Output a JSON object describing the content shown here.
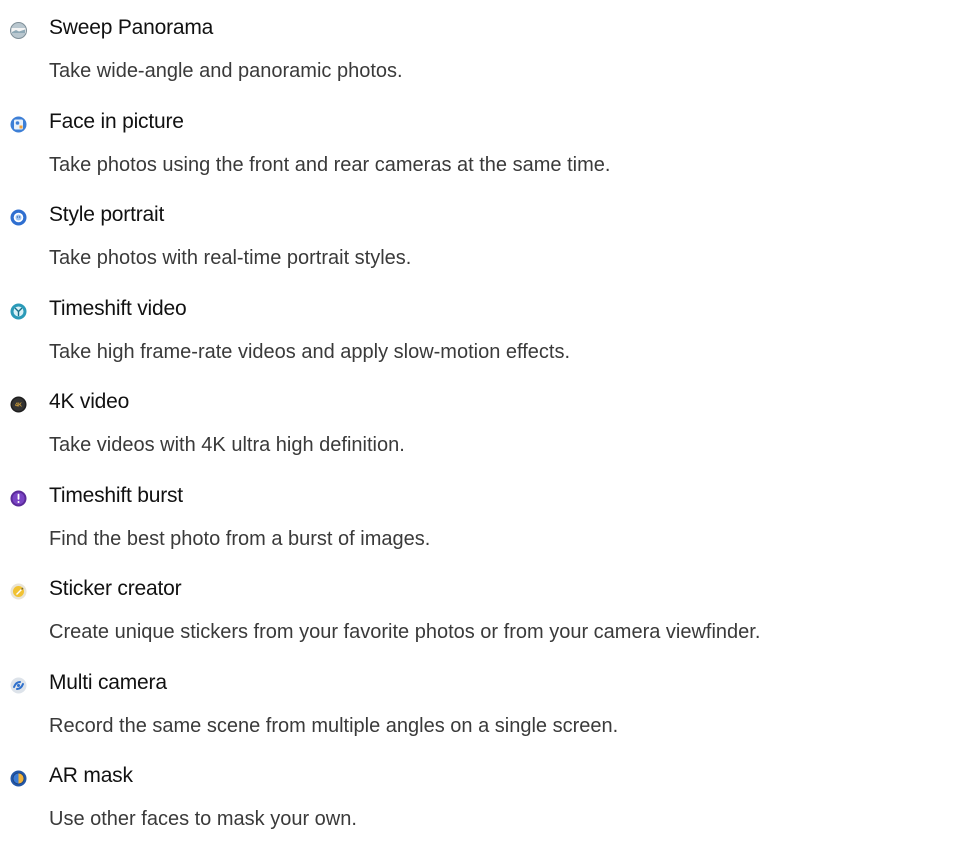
{
  "modes": [
    {
      "icon": "panorama-icon",
      "title": "Sweep Panorama",
      "description": "Take wide-angle and panoramic photos."
    },
    {
      "icon": "face-in-picture-icon",
      "title": "Face in picture",
      "description": "Take photos using the front and rear cameras at the same time."
    },
    {
      "icon": "style-portrait-icon",
      "title": "Style portrait",
      "description": "Take photos with real-time portrait styles."
    },
    {
      "icon": "timeshift-video-icon",
      "title": "Timeshift video",
      "description": "Take high frame-rate videos and apply slow-motion effects."
    },
    {
      "icon": "4k-video-icon",
      "icon_text": "4K",
      "title": "4K video",
      "description": "Take videos with 4K ultra high definition."
    },
    {
      "icon": "timeshift-burst-icon",
      "title": "Timeshift burst",
      "description": "Find the best photo from a burst of images."
    },
    {
      "icon": "sticker-creator-icon",
      "title": "Sticker creator",
      "description": "Create unique stickers from your favorite photos or from your camera viewfinder."
    },
    {
      "icon": "multi-camera-icon",
      "title": "Multi camera",
      "description": "Record the same scene from multiple angles on a single screen."
    },
    {
      "icon": "ar-mask-icon",
      "title": "AR mask",
      "description": "Use other faces to mask your own."
    }
  ]
}
